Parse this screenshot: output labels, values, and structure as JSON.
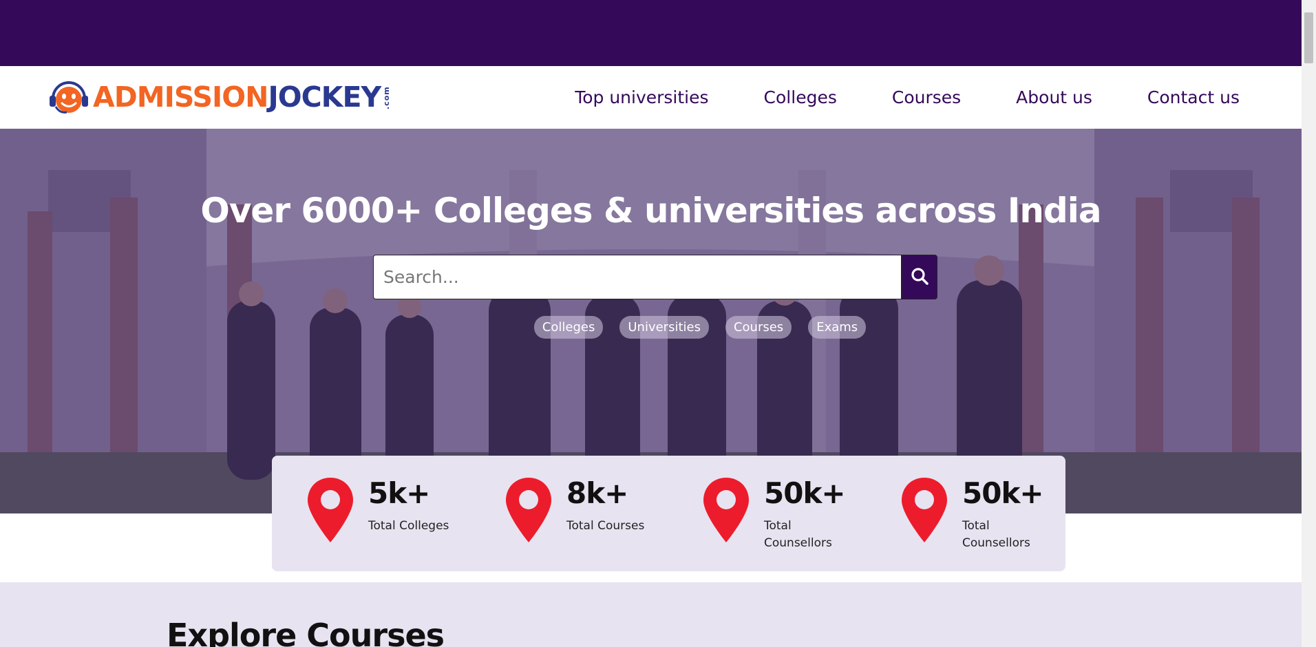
{
  "brand": {
    "name_part1": "ADMISSION",
    "name_part2": "JOCKEY",
    "tld": ".com",
    "colors": {
      "orange": "#f26522",
      "blue": "#2a3990",
      "purple": "#34095a"
    }
  },
  "nav": {
    "items": [
      {
        "label": "Top universities"
      },
      {
        "label": "Colleges"
      },
      {
        "label": "Courses"
      },
      {
        "label": "About us"
      },
      {
        "label": "Contact us"
      }
    ]
  },
  "hero": {
    "title": "Over 6000+ Colleges & universities across India",
    "search": {
      "placeholder": "Search...",
      "value": "",
      "button_icon": "search-icon"
    },
    "chips": [
      {
        "label": "Colleges"
      },
      {
        "label": "Universities"
      },
      {
        "label": "Courses"
      },
      {
        "label": "Exams"
      }
    ]
  },
  "stats": [
    {
      "value": "5k+",
      "label": "Total Colleges",
      "icon": "map-pin-icon"
    },
    {
      "value": "8k+",
      "label": "Total Courses",
      "icon": "map-pin-icon"
    },
    {
      "value": "50k+",
      "label": "Total Counsellors",
      "icon": "map-pin-icon"
    },
    {
      "value": "50k+",
      "label": "Total Counsellors",
      "icon": "map-pin-icon"
    }
  ],
  "explore": {
    "title": "Explore Courses"
  }
}
